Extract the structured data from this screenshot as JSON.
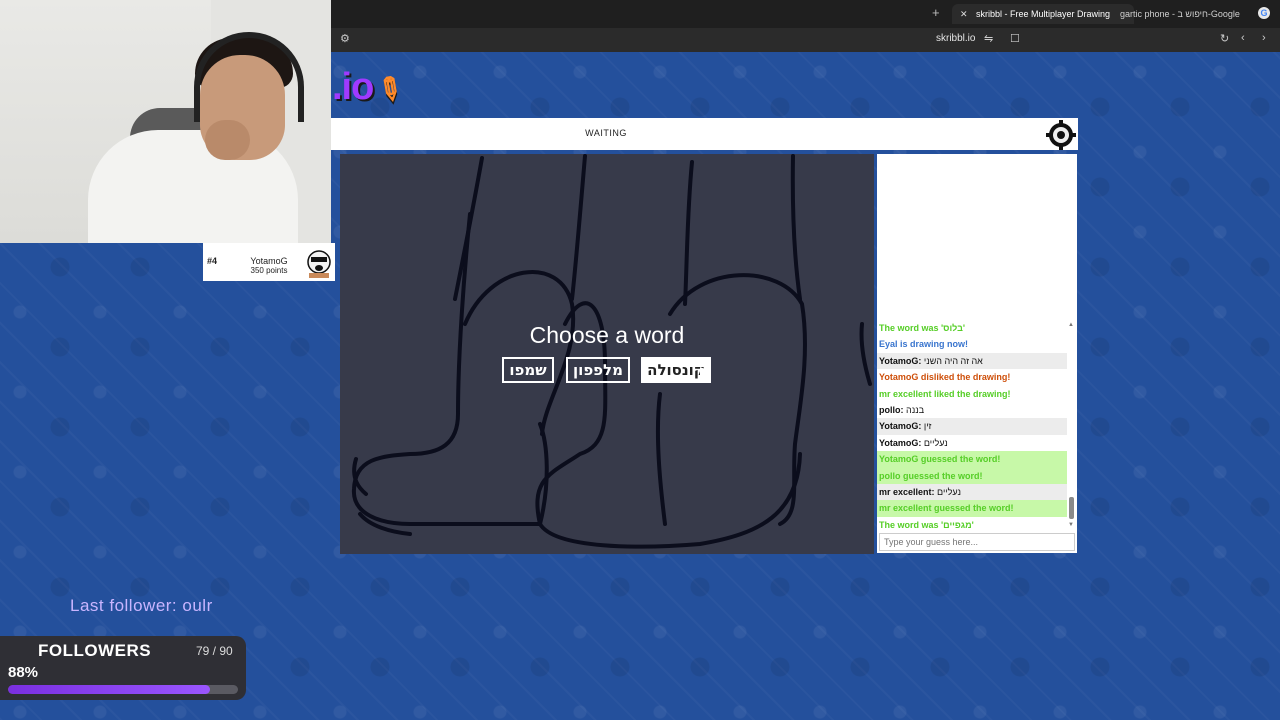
{
  "browser": {
    "active_tab": "skribbl - Free Multiplayer Drawing",
    "other_tab": "gartic phone - חיפוש ב-Google",
    "url": "skribbl.io"
  },
  "game": {
    "logo_text": ".io",
    "status": "WAITING",
    "prompt": "Choose a word",
    "words": [
      "שמפו",
      "מלפפון",
      "קונסולה"
    ],
    "selected_word_index": 2
  },
  "chat": {
    "messages": [
      {
        "type": "system-green",
        "text": "The word was 'בלוס'"
      },
      {
        "type": "system-blue",
        "text": "Eyal is drawing now!"
      },
      {
        "type": "user",
        "who": "YotamoG:",
        "text": "אה זה היה השני"
      },
      {
        "type": "system-orange",
        "text": "YotamoG disliked the drawing!"
      },
      {
        "type": "system-green",
        "text": "mr excellent liked the drawing!"
      },
      {
        "type": "user",
        "who": "pollo:",
        "text": "בננה"
      },
      {
        "type": "user",
        "who": "YotamoG:",
        "text": "זין"
      },
      {
        "type": "user",
        "who": "YotamoG:",
        "text": "נעליים"
      },
      {
        "type": "guessed",
        "text": "YotamoG guessed the word!"
      },
      {
        "type": "guessed",
        "text": "pollo guessed the word!"
      },
      {
        "type": "user",
        "who": "mr excellent:",
        "text": "נעליים"
      },
      {
        "type": "guessed",
        "text": "mr excellent guessed the word!"
      },
      {
        "type": "system-green",
        "text": "The word was 'מגפיים'"
      }
    ],
    "guess_placeholder": "Type your guess here..."
  },
  "player": {
    "rank": "#4",
    "name": "YotamoG",
    "points": "350 points"
  },
  "overlay": {
    "last_follower": "Last follower: oulr",
    "followers_label": "FOLLOWERS",
    "followers_count": "79 / 90",
    "followers_percent": "88%",
    "followers_progress": 0.88
  },
  "colors": {
    "background": "#24509c",
    "canvas": "#373a4a",
    "accent_green": "#56ce27",
    "accent_blue": "#3975ce",
    "accent_orange": "#ce4f0a",
    "progress_purple": "#7a2fe0"
  }
}
